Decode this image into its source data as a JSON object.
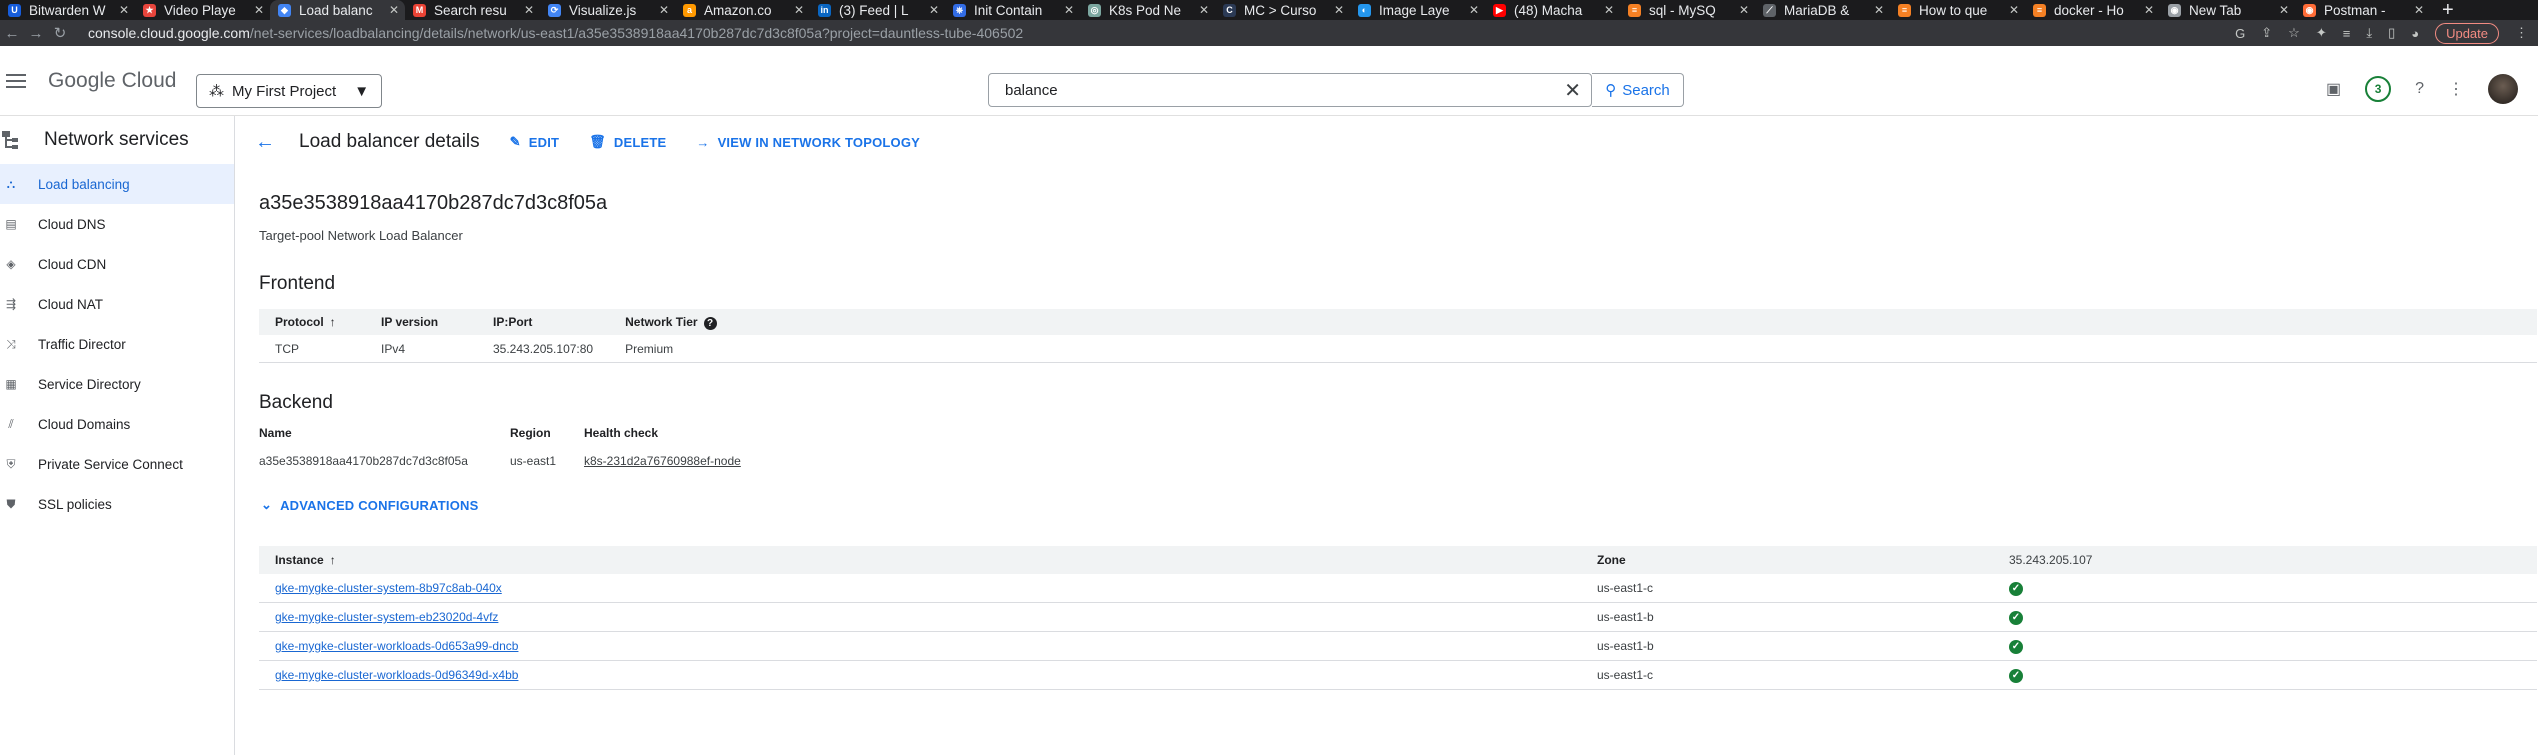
{
  "browser": {
    "tabs": [
      {
        "title": "Bitwarden W",
        "fav": "U",
        "color": "#175ddc"
      },
      {
        "title": "Video Playe",
        "fav": "★",
        "color": "#e8453c"
      },
      {
        "title": "Load balanc",
        "fav": "◆",
        "color": "#4285f4",
        "active": true
      },
      {
        "title": "Search resu",
        "fav": "M",
        "color": "#ea4335"
      },
      {
        "title": "Visualize.js",
        "fav": "⟳",
        "color": "#4285f4"
      },
      {
        "title": "Amazon.co",
        "fav": "a",
        "color": "#ff9900"
      },
      {
        "title": "(3) Feed | L",
        "fav": "in",
        "color": "#0a66c2"
      },
      {
        "title": "Init Contain",
        "fav": "⎈",
        "color": "#326ce5"
      },
      {
        "title": "K8s Pod Ne",
        "fav": "◎",
        "color": "#7ca7a0"
      },
      {
        "title": "MC > Curso",
        "fav": "C",
        "color": "#2b3a55"
      },
      {
        "title": "Image Laye",
        "fav": "◐",
        "color": "#2496ed"
      },
      {
        "title": "(48) Macha",
        "fav": "▶",
        "color": "#ff0000"
      },
      {
        "title": "sql - MySQ",
        "fav": "≡",
        "color": "#f48024"
      },
      {
        "title": "MariaDB & ",
        "fav": "⟋",
        "color": "#5f6368"
      },
      {
        "title": "How to que",
        "fav": "≡",
        "color": "#f48024"
      },
      {
        "title": "docker - Ho",
        "fav": "≡",
        "color": "#f48024"
      },
      {
        "title": "New Tab",
        "fav": "◉",
        "color": "#9aa0a6"
      },
      {
        "title": "Postman - ",
        "fav": "◉",
        "color": "#ff6c37"
      }
    ],
    "url_host": "console.cloud.google.com",
    "url_path": "/net-services/loadbalancing/details/network/us-east1/a35e3538918aa4170b287dc7d3c8f05a?project=dauntless-tube-406502",
    "update_label": "Update"
  },
  "header": {
    "logo_google": "Google",
    "logo_cloud": "Cloud",
    "project": "My First Project",
    "search_value": "balance",
    "search_button": "Search",
    "notifications": "3"
  },
  "sidebar": {
    "title": "Network services",
    "items": [
      {
        "label": "Load balancing",
        "icon": "load-balancing-icon",
        "active": true
      },
      {
        "label": "Cloud DNS",
        "icon": "dns-icon"
      },
      {
        "label": "Cloud CDN",
        "icon": "cdn-icon"
      },
      {
        "label": "Cloud NAT",
        "icon": "nat-icon"
      },
      {
        "label": "Traffic Director",
        "icon": "traffic-director-icon"
      },
      {
        "label": "Service Directory",
        "icon": "service-directory-icon"
      },
      {
        "label": "Cloud Domains",
        "icon": "domains-icon"
      },
      {
        "label": "Private Service Connect",
        "icon": "private-service-connect-icon"
      },
      {
        "label": "SSL policies",
        "icon": "ssl-policies-icon"
      }
    ]
  },
  "toolbar": {
    "title": "Load balancer details",
    "edit": "EDIT",
    "delete": "DELETE",
    "topology": "VIEW IN NETWORK TOPOLOGY"
  },
  "lb": {
    "name": "a35e3538918aa4170b287dc7d3c8f05a",
    "type": "Target-pool Network Load Balancer"
  },
  "frontend": {
    "heading": "Frontend",
    "columns": [
      "Protocol",
      "IP version",
      "IP:Port",
      "Network Tier"
    ],
    "row": [
      "TCP",
      "IPv4",
      "35.243.205.107:80",
      "Premium"
    ]
  },
  "backend": {
    "heading": "Backend",
    "name_label": "Name",
    "name_value": "a35e3538918aa4170b287dc7d3c8f05a",
    "region_label": "Region",
    "region_value": "us-east1",
    "health_label": "Health check",
    "health_value": "k8s-231d2a76760988ef-node"
  },
  "advanced": "ADVANCED CONFIGURATIONS",
  "instances": {
    "columns": [
      "Instance",
      "Zone",
      "35.243.205.107"
    ],
    "rows": [
      {
        "name": "gke-mygke-cluster-system-8b97c8ab-040x",
        "zone": "us-east1-c"
      },
      {
        "name": "gke-mygke-cluster-system-eb23020d-4vfz",
        "zone": "us-east1-b"
      },
      {
        "name": "gke-mygke-cluster-workloads-0d653a99-dncb",
        "zone": "us-east1-b"
      },
      {
        "name": "gke-mygke-cluster-workloads-0d96349d-x4bb",
        "zone": "us-east1-c"
      }
    ]
  }
}
